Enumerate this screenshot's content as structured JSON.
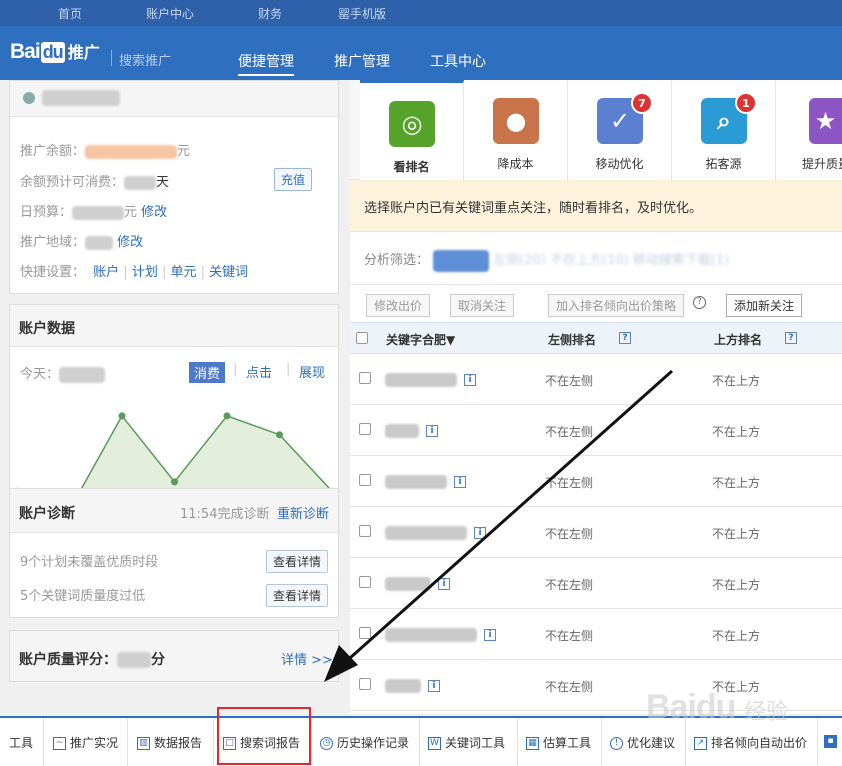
{
  "top_nav": [
    "首页",
    "账户中心",
    "财务",
    "罂手机版"
  ],
  "brand": {
    "logo_a": "Bai",
    "logo_b": "du",
    "logo_c": "推广",
    "sub": "搜索推广"
  },
  "header_nav": [
    {
      "label": "便捷管理",
      "active": true
    },
    {
      "label": "推广管理",
      "active": false
    },
    {
      "label": "工具中心",
      "active": false
    }
  ],
  "account": {
    "balance_label": "推广余额：",
    "balance_unit": "元",
    "est_label": "余额预计可消费：",
    "est_unit": "天",
    "recharge": "充值",
    "budget_label": "日预算：",
    "budget_unit": "元",
    "budget_edit": "修改",
    "region_label": "推广地域：",
    "region_edit": "修改",
    "quick_label": "快捷设置：",
    "quick_links": [
      "账户",
      "计划",
      "单元",
      "关键词"
    ]
  },
  "account_data": {
    "title": "账户数据",
    "today_label": "今天：",
    "tabs": [
      {
        "label": "消费",
        "active": true
      },
      {
        "label": "点击",
        "active": false
      },
      {
        "label": "展现",
        "active": false
      }
    ]
  },
  "chart_data": {
    "type": "area",
    "values": [
      4,
      2,
      12,
      5,
      12,
      10,
      4
    ],
    "ylim": [
      0,
      14
    ],
    "color": "#5a9a5a",
    "fill": "#e3efdc"
  },
  "diagnosis": {
    "title": "账户诊断",
    "time": "11:54完成诊断",
    "rediagnose": "重新诊断",
    "items": [
      {
        "text": "9个计划未覆盖优质时段",
        "btn": "查看详情"
      },
      {
        "text": "5个关键词质量度过低",
        "btn": "查看详情"
      }
    ]
  },
  "quality": {
    "title_a": "账户质量评分：",
    "title_b": "分",
    "detail": "详情 >>"
  },
  "tools": [
    {
      "label": "看排名",
      "icon": "target-icon",
      "color": "#55a32a",
      "badge": ""
    },
    {
      "label": "降成本",
      "icon": "piggy-bank-icon",
      "color": "#c8734a",
      "badge": ""
    },
    {
      "label": "移动优化",
      "icon": "mobile-check-icon",
      "color": "#5b7fd1",
      "badge": "7"
    },
    {
      "label": "拓客源",
      "icon": "magnifier-icon",
      "color": "#2b9bd6",
      "badge": "1"
    },
    {
      "label": "提升质量",
      "icon": "stars-icon",
      "color": "#8d55c4",
      "badge": ""
    }
  ],
  "tip": "选择账户内已有关键词重点关注，随时看排名，及时优化。",
  "filter": {
    "label": "分析筛选：",
    "text": "左侧(20)  不在上方(10)  移动搜索下载(1)"
  },
  "actions": [
    "修改出价",
    "取消关注",
    "加入排名倾向出价策略",
    "添加新关注"
  ],
  "table": {
    "headers": {
      "keyword": "关键字合肥▼",
      "left": "左侧排名",
      "top": "上方排名"
    },
    "rows": [
      {
        "left": "不在左侧",
        "top": "不在上方",
        "w": 72
      },
      {
        "left": "不在左侧",
        "top": "不在上方",
        "w": 34
      },
      {
        "left": "不在左侧",
        "top": "不在上方",
        "w": 62
      },
      {
        "left": "不在左侧",
        "top": "不在上方",
        "w": 82
      },
      {
        "left": "不在左侧",
        "top": "不在上方",
        "w": 46
      },
      {
        "left": "不在左侧",
        "top": "不在上方",
        "w": 92
      },
      {
        "left": "不在左侧",
        "top": "不在上方",
        "w": 36
      }
    ]
  },
  "bottom": [
    {
      "label": "工具",
      "icon": ""
    },
    {
      "label": "推广实况",
      "icon": "monitor-icon"
    },
    {
      "label": "数据报告",
      "icon": "bar-chart-icon"
    },
    {
      "label": "搜索词报告",
      "icon": "search-report-icon"
    },
    {
      "label": "历史操作记录",
      "icon": "clock-icon"
    },
    {
      "label": "关键词工具",
      "icon": "word-icon"
    },
    {
      "label": "估算工具",
      "icon": "calculator-icon"
    },
    {
      "label": "优化建议",
      "icon": "alert-icon"
    },
    {
      "label": "排名倾向自动出价",
      "icon": "ranking-icon"
    }
  ],
  "watermark": {
    "a": "Baidu",
    "b": "经验"
  }
}
